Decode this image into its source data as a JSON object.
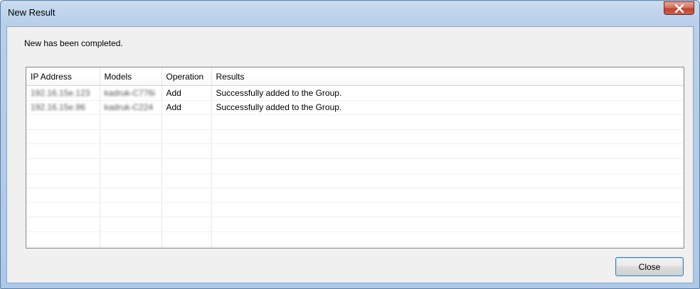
{
  "window": {
    "title": "New Result",
    "close_icon": "close-x-icon"
  },
  "message": "New has been completed.",
  "table": {
    "columns": [
      "IP Address",
      "Models",
      "Operation",
      "Results"
    ],
    "rows": [
      {
        "ip": "192.16.15e.123",
        "model": "kadruk-C776i",
        "operation": "Add",
        "result": "Successfully added to the Group."
      },
      {
        "ip": "192.16.15e.96",
        "model": "kadruk-C224",
        "operation": "Add",
        "result": "Successfully added to the Group."
      }
    ],
    "empty_rows": 10
  },
  "buttons": {
    "close_label": "Close"
  },
  "colors": {
    "title_bar": "#b9cfe9",
    "close_x": "#c0432c",
    "client_bg": "#f0f0f0"
  }
}
